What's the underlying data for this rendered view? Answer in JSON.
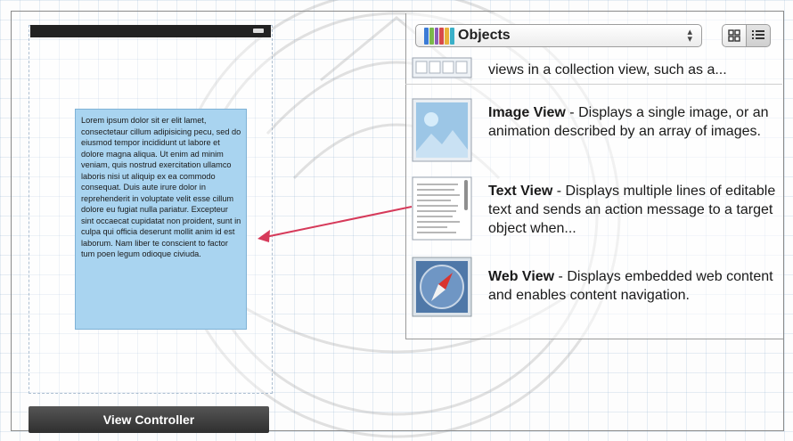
{
  "library": {
    "dropdown_label": "Objects",
    "dropdown_icon": "objects-library-icon",
    "grid_view_icon": "grid-view-icon",
    "list_view_icon": "list-view-icon",
    "items": [
      {
        "title": "",
        "description": "views in a collection view, such as a...",
        "icon": "collection-view-icon"
      },
      {
        "title": "Image View",
        "description": " - Displays a single image, or an animation described by an array of images.",
        "icon": "image-view-icon"
      },
      {
        "title": "Text View",
        "description": " - Displays multiple lines of editable text and sends an action message to a target object when...",
        "icon": "text-view-icon"
      },
      {
        "title": "Web View",
        "description": " - Displays embedded web content and enables content navigation.",
        "icon": "web-view-icon"
      }
    ]
  },
  "canvas": {
    "text_view_content": "Lorem ipsum dolor sit er elit lamet, consectetaur cillum adipisicing pecu, sed do eiusmod tempor incididunt ut labore et dolore magna aliqua. Ut enim ad minim veniam, quis nostrud exercitation ullamco laboris nisi ut aliquip ex ea commodo consequat. Duis aute irure dolor in reprehenderit in voluptate velit esse cillum dolore eu fugiat nulla pariatur. Excepteur sint occaecat cupidatat non proident, sunt in culpa qui officia deserunt mollit anim id est laborum. Nam liber te conscient to factor tum poen legum odioque civiuda.",
    "view_controller_label": "View Controller"
  },
  "colors": {
    "text_view_bg": "#a9d4f0",
    "arrow": "#d63a5a",
    "view_controller_bar": "#3a3a3a"
  }
}
